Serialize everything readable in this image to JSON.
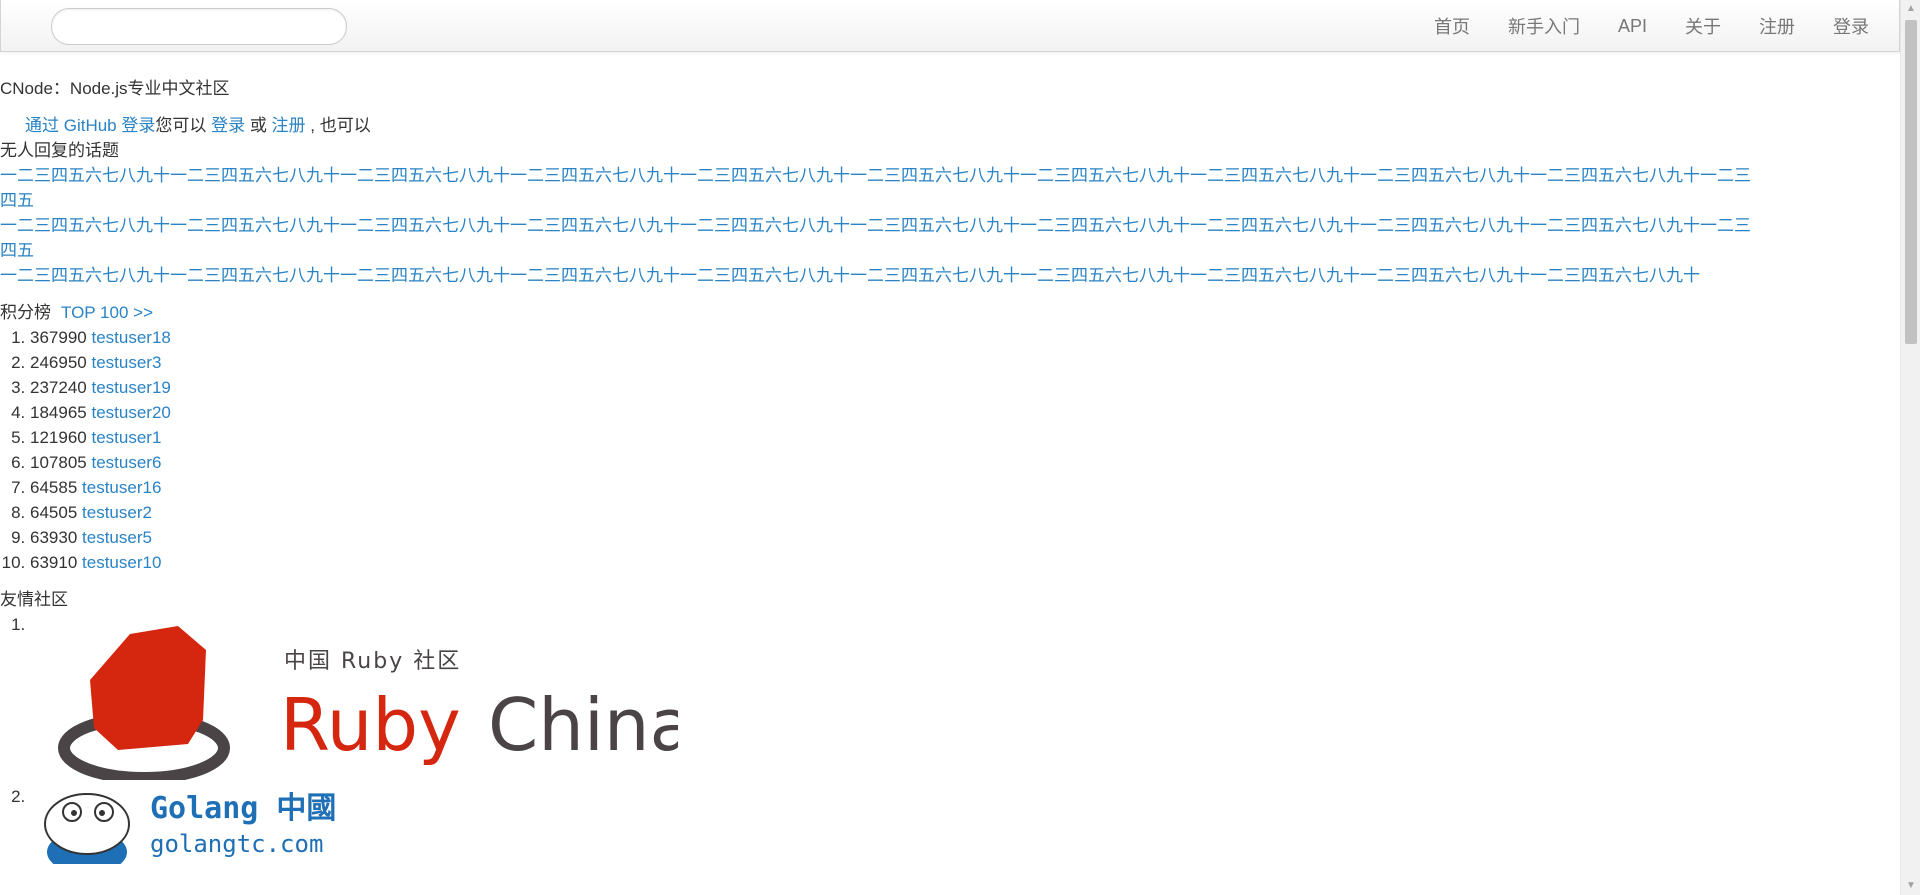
{
  "navbar": {
    "search_placeholder": "",
    "links": [
      "首页",
      "新手入门",
      "API",
      "关于",
      "注册",
      "登录"
    ]
  },
  "brand": "CNode：Node.js专业中文社区",
  "auth": {
    "github_link": "通过 GitHub 登录",
    "text_1": "您可以 ",
    "login_link": "登录",
    "text_2": " 或 ",
    "register_link": "注册",
    "text_3": " , 也可以"
  },
  "no_reply": {
    "title": "无人回复的话题",
    "topics": [
      "一二三四五六七八九十一二三四五六七八九十一二三四五六七八九十一二三四五六七八九十一二三四五六七八九十一二三四五六七八九十一二三四五六七八九十一二三四五六七八九十一二三四五六七八九十一二三四五六七八九十一二三四五",
      "一二三四五六七八九十一二三四五六七八九十一二三四五六七八九十一二三四五六七八九十一二三四五六七八九十一二三四五六七八九十一二三四五六七八九十一二三四五六七八九十一二三四五六七八九十一二三四五六七八九十一二三四五",
      "一二三四五六七八九十一二三四五六七八九十一二三四五六七八九十一二三四五六七八九十一二三四五六七八九十一二三四五六七八九十一二三四五六七八九十一二三四五六七八九十一二三四五六七八九十一二三四五六七八九十"
    ]
  },
  "score_board": {
    "title": "积分榜",
    "top_link": "TOP 100 >>",
    "entries": [
      {
        "score": "367990",
        "user": "testuser18"
      },
      {
        "score": "246950",
        "user": "testuser3"
      },
      {
        "score": "237240",
        "user": "testuser19"
      },
      {
        "score": "184965",
        "user": "testuser20"
      },
      {
        "score": "121960",
        "user": "testuser1"
      },
      {
        "score": "107805",
        "user": "testuser6"
      },
      {
        "score": "64585",
        "user": "testuser16"
      },
      {
        "score": "64505",
        "user": "testuser2"
      },
      {
        "score": "63930",
        "user": "testuser5"
      },
      {
        "score": "63910",
        "user": "testuser10"
      }
    ]
  },
  "friends": {
    "title": "友情社区",
    "ruby": {
      "small": "中国 Ruby 社区",
      "ruby_word": "Ruby",
      "china_word": "China"
    },
    "golang": {
      "title": "Golang 中國",
      "domain": "golangtc.com"
    }
  },
  "colors": {
    "link": "#2a83c5",
    "text": "#333333",
    "ruby_red": "#d5260f",
    "ruby_gray": "#4a4446",
    "golang_blue": "#1e6fb5"
  }
}
